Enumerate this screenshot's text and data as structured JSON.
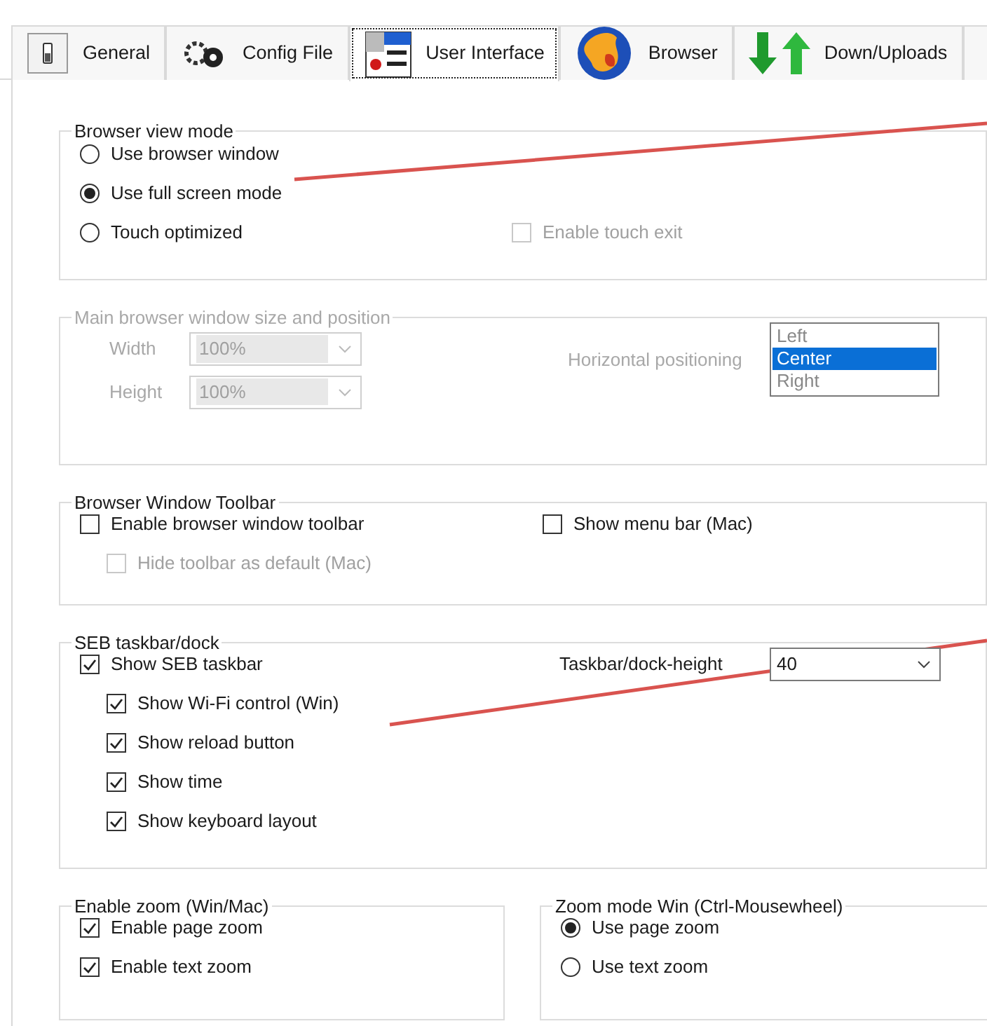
{
  "tabs": [
    {
      "label": "General",
      "selected": false,
      "kind": "switch"
    },
    {
      "label": "Config File",
      "selected": false,
      "kind": "gears"
    },
    {
      "label": "User Interface",
      "selected": true,
      "kind": "window"
    },
    {
      "label": "Browser",
      "selected": false,
      "kind": "globe"
    },
    {
      "label": "Down/Uploads",
      "selected": false,
      "kind": "arrows"
    }
  ],
  "browser_view_mode": {
    "title": "Browser view mode",
    "options": [
      {
        "label": "Use browser window",
        "selected": false
      },
      {
        "label": "Use full screen mode",
        "selected": true
      },
      {
        "label": "Touch optimized",
        "selected": false
      }
    ],
    "enable_touch_exit": {
      "label": "Enable touch exit",
      "checked": false,
      "disabled": true
    }
  },
  "window_size": {
    "title": "Main browser window size and position",
    "disabled": true,
    "width": {
      "label": "Width",
      "value": "100%"
    },
    "height": {
      "label": "Height",
      "value": "100%"
    },
    "horizontal_positioning": {
      "label": "Horizontal positioning",
      "options": [
        {
          "label": "Left",
          "selected": false
        },
        {
          "label": "Center",
          "selected": true
        },
        {
          "label": "Right",
          "selected": false
        }
      ]
    }
  },
  "toolbar": {
    "title": "Browser Window Toolbar",
    "enable_toolbar": {
      "label": "Enable browser window toolbar",
      "checked": false,
      "children": [
        {
          "label": "Hide toolbar as default (Mac)",
          "checked": false,
          "disabled": true
        }
      ]
    },
    "show_menu_bar": {
      "label": "Show menu bar (Mac)",
      "checked": false
    }
  },
  "taskbar": {
    "title": "SEB taskbar/dock",
    "show_taskbar": {
      "label": "Show SEB taskbar",
      "checked": true,
      "children": [
        {
          "label": "Show Wi-Fi control (Win)",
          "checked": true,
          "disabled": false
        },
        {
          "label": "Show reload button",
          "checked": true,
          "disabled": false
        },
        {
          "label": "Show time",
          "checked": true,
          "disabled": false
        },
        {
          "label": "Show keyboard layout",
          "checked": true,
          "disabled": false
        }
      ]
    },
    "height": {
      "label": "Taskbar/dock-height",
      "value": "40"
    }
  },
  "zoom": {
    "title": "Enable zoom (Win/Mac)",
    "items": [
      {
        "label": "Enable page zoom",
        "checked": true,
        "disabled": false
      },
      {
        "label": "Enable text zoom",
        "checked": true,
        "disabled": false
      }
    ]
  },
  "zoom_mode": {
    "title": "Zoom mode Win (Ctrl-Mousewheel)",
    "options": [
      {
        "label": "Use page zoom",
        "selected": true
      },
      {
        "label": "Use text zoom",
        "selected": false
      }
    ]
  }
}
